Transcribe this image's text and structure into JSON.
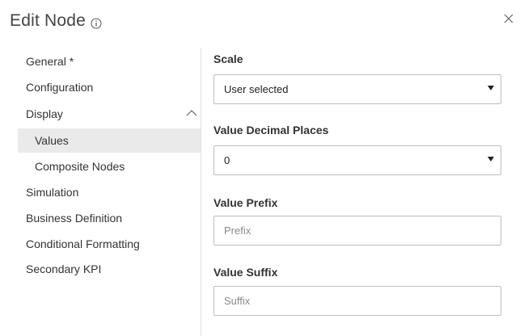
{
  "dialog": {
    "title": "Edit Node"
  },
  "nav": {
    "items": [
      {
        "label": "General *"
      },
      {
        "label": "Configuration"
      },
      {
        "label": "Display"
      },
      {
        "label": "Values"
      },
      {
        "label": "Composite Nodes"
      },
      {
        "label": "Simulation"
      },
      {
        "label": "Business Definition"
      },
      {
        "label": "Conditional Formatting"
      },
      {
        "label": "Secondary KPI"
      }
    ],
    "active_item": "Values"
  },
  "form": {
    "scale": {
      "label": "Scale",
      "value": "User selected"
    },
    "decimal_places": {
      "label": "Value Decimal Places",
      "value": "0"
    },
    "prefix": {
      "label": "Value Prefix",
      "value": "",
      "placeholder": "Prefix"
    },
    "suffix": {
      "label": "Value Suffix",
      "value": "",
      "placeholder": "Suffix"
    }
  },
  "icons": {
    "info": "info-icon",
    "close": "close-icon",
    "display_toggle": "chevron-up-icon",
    "dropdown": "caret-down-icon"
  },
  "colors": {
    "active_nav_bg": "#eaeaea",
    "border": "#bfbfbf",
    "divider": "#e1e1e1"
  }
}
